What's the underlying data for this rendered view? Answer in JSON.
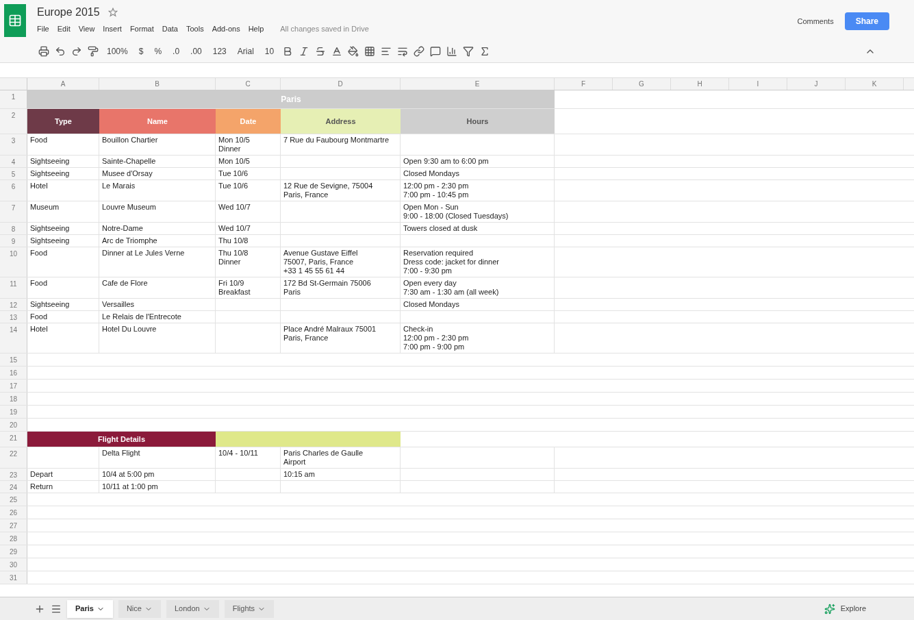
{
  "document": {
    "title": "Europe 2015",
    "menu": [
      "File",
      "Edit",
      "View",
      "Insert",
      "Format",
      "Data",
      "Tools",
      "Add-ons",
      "Help"
    ],
    "save_status": "All changes saved in Drive",
    "comments": "Comments",
    "share": "Share"
  },
  "toolbar": {
    "zoom": "100%",
    "currency": "$",
    "percent": "%",
    "decimals_less": ".0",
    "decimals_more": ".00",
    "number_format": "123",
    "font": "Arial",
    "font_size": "10"
  },
  "columns": [
    "A",
    "B",
    "C",
    "D",
    "E",
    "F",
    "G",
    "H",
    "I",
    "J",
    "K"
  ],
  "rows": [
    {
      "number": "1",
      "kind": "title",
      "cells": [
        "Paris"
      ]
    },
    {
      "number": "2",
      "kind": "header",
      "cells": [
        {
          "text": "Type",
          "color": "#6e3a48"
        },
        {
          "text": "Name",
          "color": "#e8756a"
        },
        {
          "text": "Date",
          "color": "#f4a46a"
        },
        {
          "text": "Address",
          "color": "#e6efb4"
        },
        {
          "text": "Hours",
          "color": "#cfcfcf"
        }
      ]
    },
    {
      "number": "3",
      "kind": "data",
      "cells": [
        "Food",
        "Bouillon Chartier",
        "Mon 10/5\nDinner",
        "7 Rue du Faubourg Montmartre",
        ""
      ]
    },
    {
      "number": "4",
      "kind": "data",
      "cells": [
        "Sightseeing",
        "Sainte-Chapelle",
        "Mon 10/5",
        "",
        "Open 9:30 am to 6:00 pm"
      ]
    },
    {
      "number": "5",
      "kind": "data",
      "cells": [
        "Sightseeing",
        "Musee d'Orsay",
        "Tue 10/6",
        "",
        "Closed Mondays"
      ]
    },
    {
      "number": "6",
      "kind": "data",
      "cells": [
        "Hotel",
        "Le Marais",
        "Tue 10/6",
        "12 Rue de Sevigne, 75004\nParis, France",
        "12:00 pm - 2:30 pm\n7:00 pm - 10:45 pm"
      ]
    },
    {
      "number": "7",
      "kind": "data",
      "cells": [
        "Museum",
        "Louvre Museum",
        "Wed 10/7",
        "",
        "Open Mon - Sun\n9:00 - 18:00 (Closed Tuesdays)"
      ]
    },
    {
      "number": "8",
      "kind": "data",
      "cells": [
        "Sightseeing",
        "Notre-Dame",
        "Wed 10/7",
        "",
        "Towers closed at dusk"
      ]
    },
    {
      "number": "9",
      "kind": "data",
      "cells": [
        "Sightseeing",
        "Arc de Triomphe",
        "Thu 10/8",
        "",
        ""
      ]
    },
    {
      "number": "10",
      "kind": "data",
      "cells": [
        "Food",
        "Dinner at Le Jules Verne",
        "Thu 10/8\nDinner",
        "Avenue Gustave Eiffel\n75007, Paris, France\n+33 1 45 55 61 44",
        "Reservation required\nDress code: jacket for dinner\n7:00 - 9:30 pm"
      ]
    },
    {
      "number": "11",
      "kind": "data",
      "cells": [
        "Food",
        "Cafe de Flore",
        "Fri 10/9\nBreakfast",
        "172 Bd St-Germain 75006\nParis",
        "Open every day\n7:30 am - 1:30 am (all week)"
      ]
    },
    {
      "number": "12",
      "kind": "data",
      "cells": [
        "Sightseeing",
        "Versailles",
        "",
        "",
        "Closed Mondays"
      ]
    },
    {
      "number": "13",
      "kind": "data",
      "cells": [
        "Food",
        "Le Relais de l'Entrecote",
        "",
        "",
        ""
      ]
    },
    {
      "number": "14",
      "kind": "data",
      "cells": [
        "Hotel",
        "Hotel Du Louvre",
        "",
        "Place André Malraux 75001\nParis, France",
        "Check-in\n12:00 pm - 2:30 pm\n7:00 pm - 9:00 pm"
      ]
    },
    {
      "number": "15",
      "kind": "blank"
    },
    {
      "number": "16",
      "kind": "blank"
    },
    {
      "number": "17",
      "kind": "blank"
    },
    {
      "number": "18",
      "kind": "blank"
    },
    {
      "number": "19",
      "kind": "blank"
    },
    {
      "number": "20",
      "kind": "blank"
    },
    {
      "number": "21",
      "kind": "flight_title",
      "cells": [
        "Flight Details"
      ]
    },
    {
      "number": "22",
      "kind": "data",
      "cells": [
        "",
        "Delta Flight",
        "10/4 - 10/11",
        "Paris Charles de Gaulle\nAirport",
        ""
      ]
    },
    {
      "number": "23",
      "kind": "data",
      "cells": [
        "Depart",
        "10/4 at 5:00 pm",
        "",
        "10:15 am",
        ""
      ]
    },
    {
      "number": "24",
      "kind": "data",
      "cells": [
        "Return",
        "10/11 at 1:00 pm",
        "",
        "",
        ""
      ]
    },
    {
      "number": "25",
      "kind": "blank"
    },
    {
      "number": "26",
      "kind": "blank"
    },
    {
      "number": "27",
      "kind": "blank"
    },
    {
      "number": "28",
      "kind": "blank"
    },
    {
      "number": "29",
      "kind": "blank"
    },
    {
      "number": "30",
      "kind": "blank"
    },
    {
      "number": "31",
      "kind": "blank"
    }
  ],
  "sheet_tabs": [
    {
      "label": "Paris",
      "selected": true
    },
    {
      "label": "Nice",
      "selected": false
    },
    {
      "label": "London",
      "selected": false
    },
    {
      "label": "Flights",
      "selected": false
    }
  ],
  "explore": "Explore"
}
